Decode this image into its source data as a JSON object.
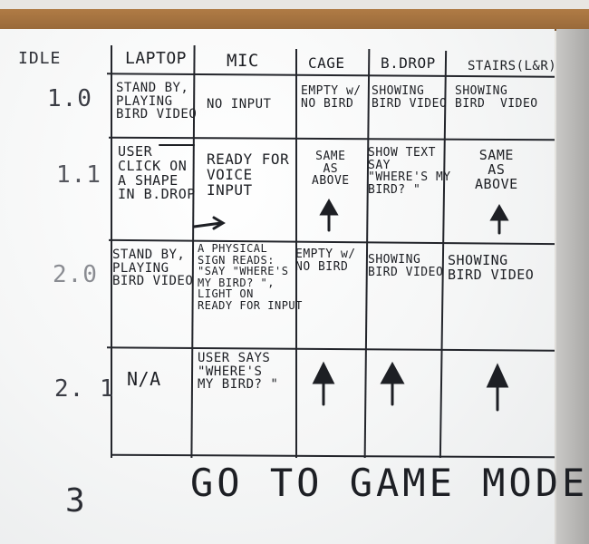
{
  "board": {
    "corner_label": "IDLE",
    "headers": [
      "LAPTOP",
      "MIC",
      "CAGE",
      "B.DROP",
      "STAIRS(L&R)"
    ],
    "rows": [
      {
        "label": "1.0",
        "laptop": "STAND BY,\nPLAYING\nBIRD VIDEO",
        "mic": "NO INPUT",
        "cage": "EMPTY w/\nNO BIRD",
        "bdrop": "SHOWING\nBIRD VIDEO",
        "stairs": "SHOWING\nBIRD  VIDEO"
      },
      {
        "label": "1.1",
        "laptop": "USER\nCLICK ON\nA SHAPE\nIN B.DROP",
        "mic": "READY FOR\nVOICE\nINPUT",
        "cage": "SAME\nAS\nABOVE",
        "bdrop": "SHOW TEXT\nSAY\n\"WHERE'S MY\nBIRD? \"",
        "stairs": "SAME\nAS\nABOVE"
      },
      {
        "label": "2.0",
        "laptop": "STAND BY,\nPLAYING\nBIRD VIDEO",
        "mic": "A PHYSICAL\nSIGN READS:\n\"SAY \"WHERE'S\nMY BIRD? \",\nLIGHT ON\nREADY FOR INPUT",
        "cage": "EMPTY w/\nNO BIRD",
        "bdrop": "SHOWING\nBIRD VIDEO",
        "stairs": "SHOWING\nBIRD VIDEO"
      },
      {
        "label": "2. 1",
        "laptop": "N/A",
        "mic": "USER SAYS\n\"WHERE'S\nMY BIRD? \"",
        "cage": "",
        "bdrop": "",
        "stairs": ""
      }
    ],
    "final_row": {
      "label": "3",
      "text": "GO TO GAME MODE"
    }
  },
  "colors": {
    "ink": "#1d1f24",
    "frame": "#a87443",
    "board": "#f7f8f8"
  }
}
